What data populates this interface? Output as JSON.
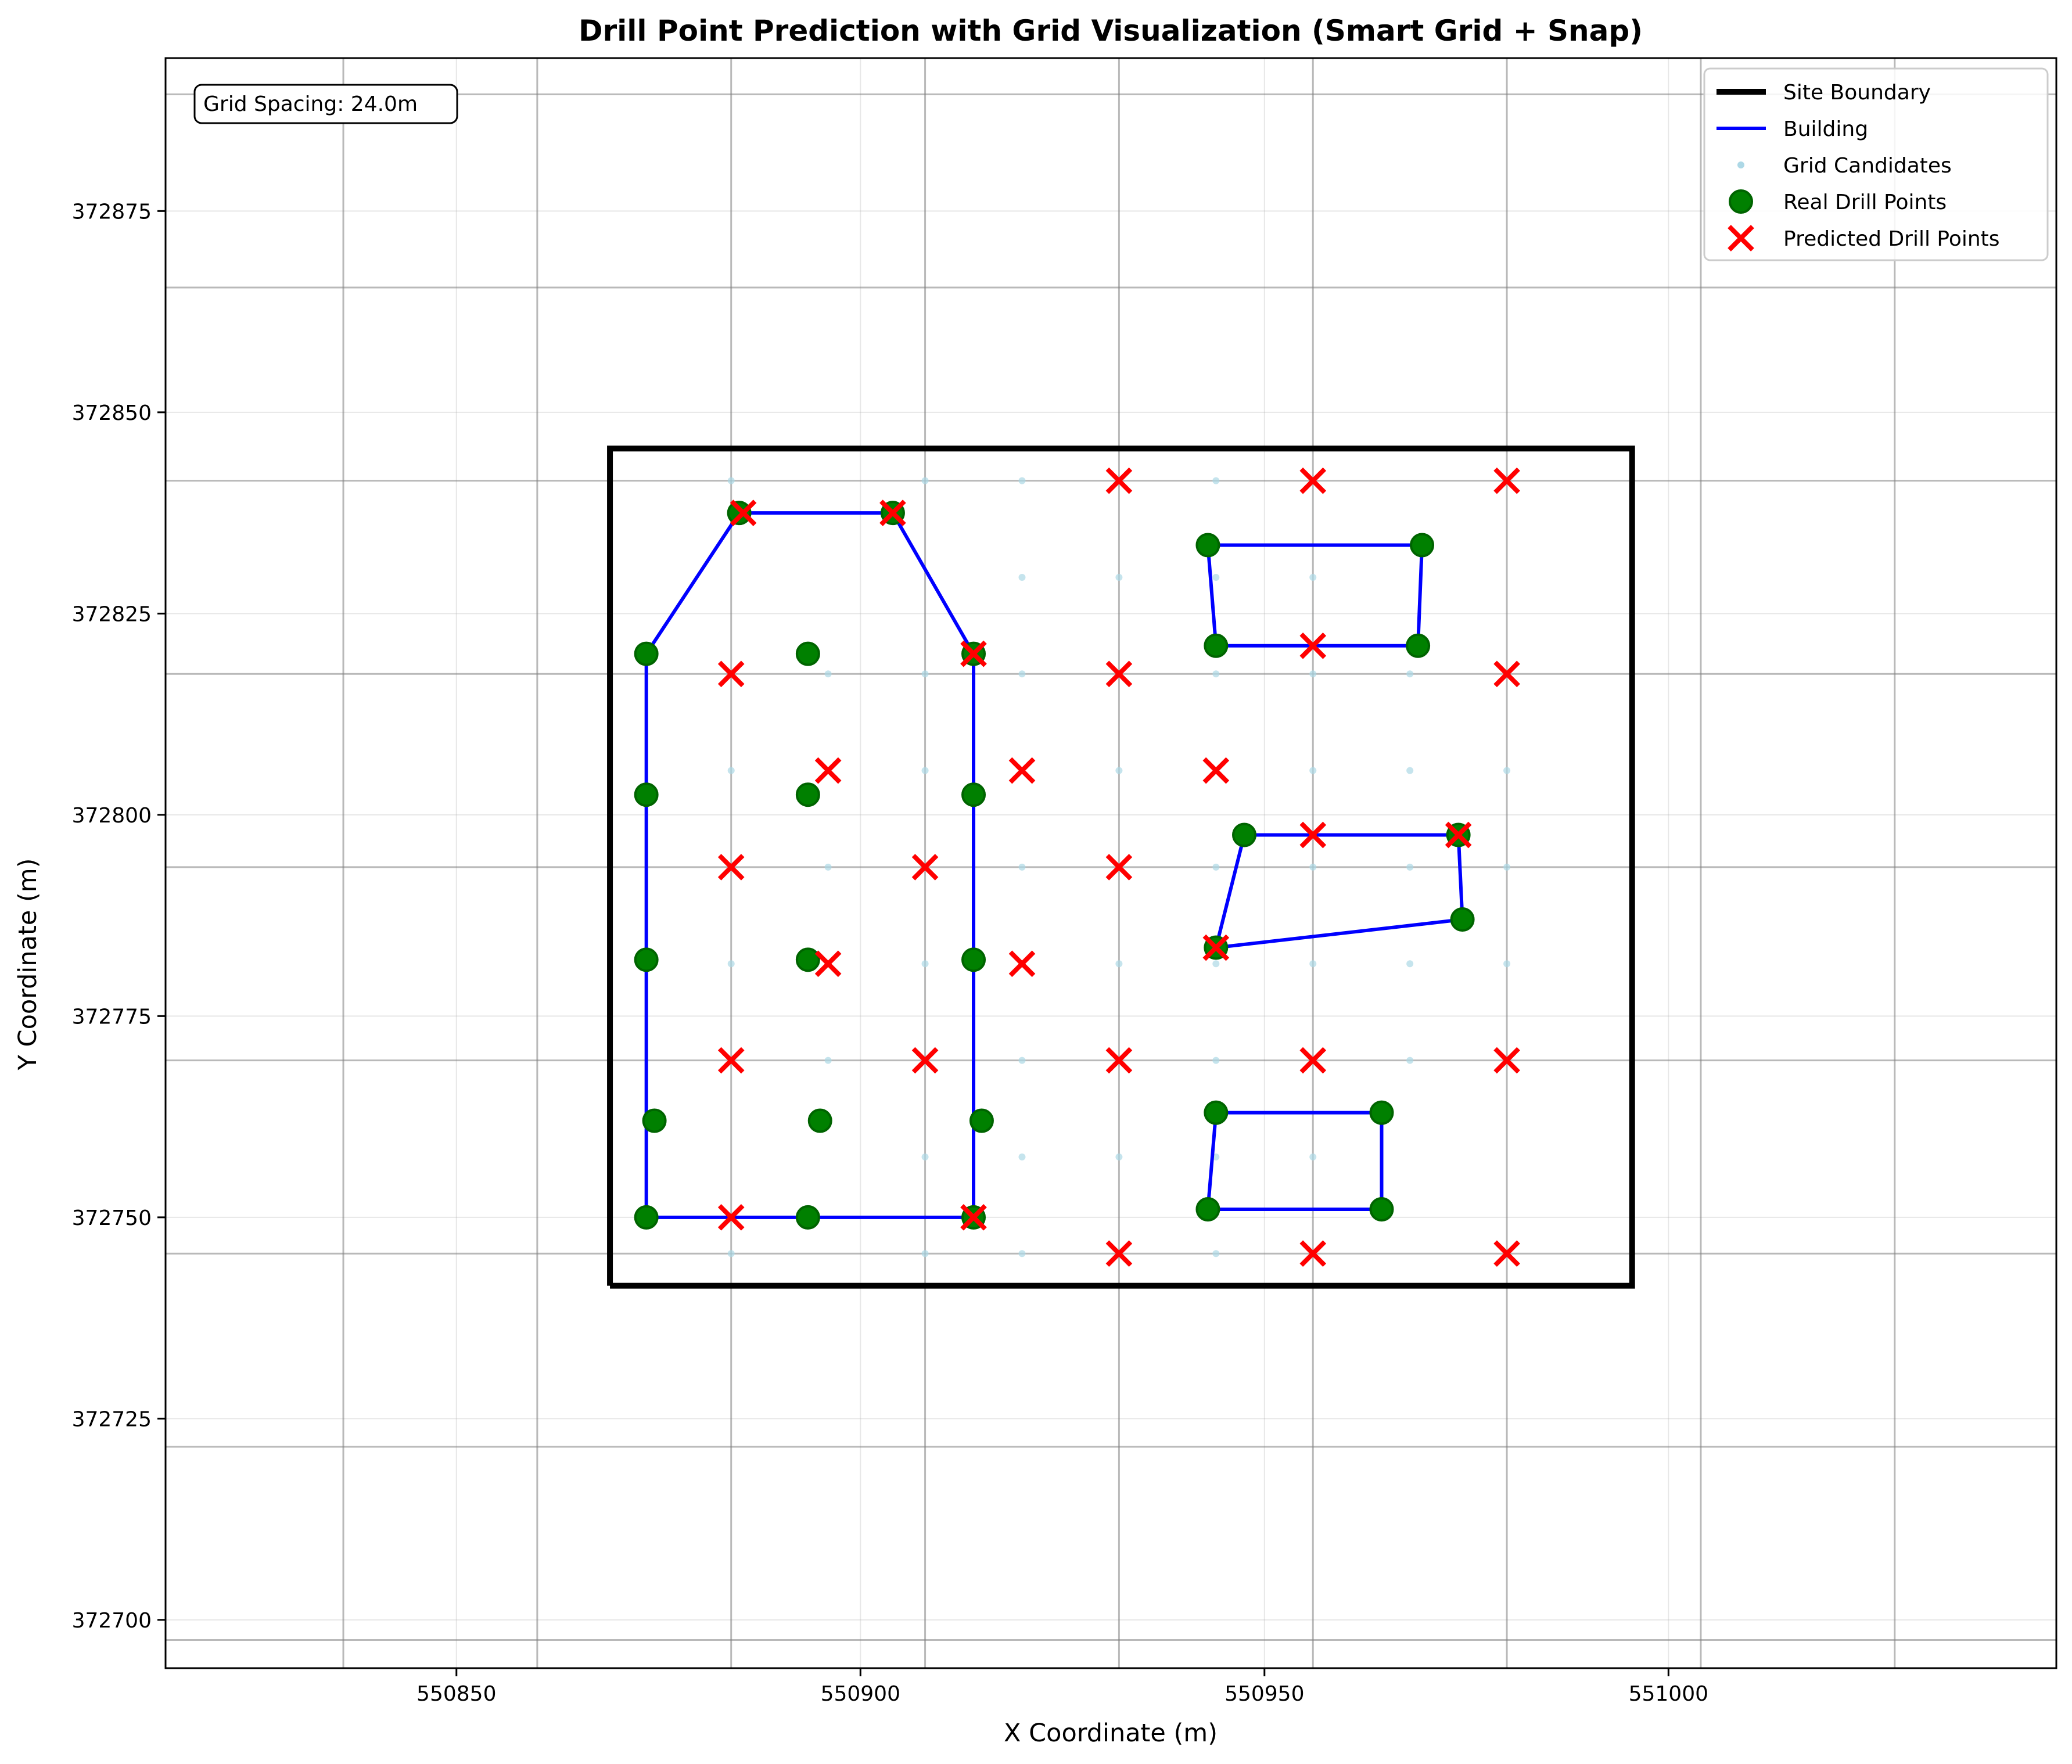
{
  "chart_data": {
    "type": "scatter",
    "title": "Drill Point Prediction with Grid Visualization (Smart Grid + Snap)",
    "xlabel": "X Coordinate (m)",
    "ylabel": "Y Coordinate (m)",
    "xlim": [
      550814,
      551048
    ],
    "ylim": [
      372694,
      372894
    ],
    "xticks": [
      550850,
      550900,
      550950,
      551000
    ],
    "yticks": [
      372700,
      372725,
      372750,
      372775,
      372800,
      372825,
      372850,
      372875
    ],
    "grid": true,
    "legend_position": "top-right",
    "annotation": "Grid Spacing: 24.0m",
    "grid_lines": {
      "x": [
        550836,
        550860,
        550884,
        550908,
        550932,
        550956,
        550980,
        551004,
        551028
      ],
      "y": [
        372697.5,
        372721.5,
        372745.5,
        372769.5,
        372793.5,
        372817.5,
        372841.5,
        372865.5,
        372889.5
      ]
    },
    "legend": [
      {
        "label": "Site Boundary",
        "kind": "line",
        "color": "#000000"
      },
      {
        "label": "Building",
        "kind": "line",
        "color": "#0000ff"
      },
      {
        "label": "Grid Candidates",
        "kind": "dot",
        "color": "#add8e6"
      },
      {
        "label": "Real Drill Points",
        "kind": "circle",
        "color": "#008000"
      },
      {
        "label": "Predicted Drill Points",
        "kind": "x",
        "color": "#ff0000"
      }
    ],
    "site_boundary": [
      [
        550869,
        372741.5
      ],
      [
        550995.5,
        372741.5
      ],
      [
        550995.5,
        372845.5
      ],
      [
        550869,
        372845.5
      ],
      [
        550869,
        372741.5
      ]
    ],
    "buildings": [
      [
        [
          550873.5,
          372750
        ],
        [
          550873.5,
          372820
        ],
        [
          550885,
          372837.5
        ],
        [
          550904,
          372837.5
        ],
        [
          550914,
          372820
        ],
        [
          550914,
          372750
        ],
        [
          550873.5,
          372750
        ]
      ],
      [
        [
          550943,
          372833.5
        ],
        [
          550969.5,
          372833.5
        ],
        [
          550969,
          372821
        ],
        [
          550944,
          372821
        ],
        [
          550943,
          372833.5
        ]
      ],
      [
        [
          550947.5,
          372797.5
        ],
        [
          550974,
          372797.5
        ],
        [
          550974.5,
          372787
        ],
        [
          550944,
          372783.5
        ],
        [
          550947.5,
          372797.5
        ]
      ],
      [
        [
          550944,
          372763
        ],
        [
          550964.5,
          372763
        ],
        [
          550964.5,
          372751
        ],
        [
          550943,
          372751
        ],
        [
          550944,
          372763
        ]
      ]
    ],
    "grid_candidates": [
      [
        550884,
        372841.5
      ],
      [
        550908,
        372841.5
      ],
      [
        550920,
        372841.5
      ],
      [
        550944,
        372841.5
      ],
      [
        550920,
        372829.5
      ],
      [
        550932,
        372829.5
      ],
      [
        550944,
        372829.5
      ],
      [
        550956,
        372829.5
      ],
      [
        550896,
        372817.5
      ],
      [
        550908,
        372817.5
      ],
      [
        550920,
        372817.5
      ],
      [
        550944,
        372817.5
      ],
      [
        550956,
        372817.5
      ],
      [
        550968,
        372817.5
      ],
      [
        550884,
        372805.5
      ],
      [
        550908,
        372805.5
      ],
      [
        550932,
        372805.5
      ],
      [
        550956,
        372805.5
      ],
      [
        550968,
        372805.5
      ],
      [
        550980,
        372805.5
      ],
      [
        550896,
        372793.5
      ],
      [
        550920,
        372793.5
      ],
      [
        550944,
        372793.5
      ],
      [
        550956,
        372793.5
      ],
      [
        550968,
        372793.5
      ],
      [
        550980,
        372793.5
      ],
      [
        550884,
        372781.5
      ],
      [
        550908,
        372781.5
      ],
      [
        550932,
        372781.5
      ],
      [
        550944,
        372781.5
      ],
      [
        550956,
        372781.5
      ],
      [
        550968,
        372781.5
      ],
      [
        550980,
        372781.5
      ],
      [
        550896,
        372769.5
      ],
      [
        550920,
        372769.5
      ],
      [
        550944,
        372769.5
      ],
      [
        550968,
        372769.5
      ],
      [
        550908,
        372757.5
      ],
      [
        550920,
        372757.5
      ],
      [
        550932,
        372757.5
      ],
      [
        550944,
        372757.5
      ],
      [
        550956,
        372757.5
      ],
      [
        550884,
        372745.5
      ],
      [
        550908,
        372745.5
      ],
      [
        550920,
        372745.5
      ],
      [
        550944,
        372745.5
      ]
    ],
    "real_drill_points": [
      [
        550873.5,
        372820
      ],
      [
        550885,
        372837.5
      ],
      [
        550904,
        372837.5
      ],
      [
        550914,
        372820
      ],
      [
        550893.5,
        372820
      ],
      [
        550873.5,
        372802.5
      ],
      [
        550893.5,
        372802.5
      ],
      [
        550914,
        372802.5
      ],
      [
        550873.5,
        372782
      ],
      [
        550893.5,
        372782
      ],
      [
        550914,
        372782
      ],
      [
        550874.5,
        372762
      ],
      [
        550895,
        372762
      ],
      [
        550915,
        372762
      ],
      [
        550873.5,
        372750
      ],
      [
        550893.5,
        372750
      ],
      [
        550914,
        372750
      ],
      [
        550943,
        372833.5
      ],
      [
        550969.5,
        372833.5
      ],
      [
        550944,
        372821
      ],
      [
        550969,
        372821
      ],
      [
        550947.5,
        372797.5
      ],
      [
        550974,
        372797.5
      ],
      [
        550974.5,
        372787
      ],
      [
        550944,
        372783.5
      ],
      [
        550944,
        372763
      ],
      [
        550964.5,
        372763
      ],
      [
        550943,
        372751
      ],
      [
        550964.5,
        372751
      ]
    ],
    "predicted_drill_points": [
      [
        550885.5,
        372837.5
      ],
      [
        550904,
        372837.5
      ],
      [
        550932,
        372841.5
      ],
      [
        550956,
        372841.5
      ],
      [
        550980,
        372841.5
      ],
      [
        550884,
        372817.5
      ],
      [
        550914,
        372820
      ],
      [
        550932,
        372817.5
      ],
      [
        550956,
        372821
      ],
      [
        550980,
        372817.5
      ],
      [
        550896,
        372805.5
      ],
      [
        550920,
        372805.5
      ],
      [
        550944,
        372805.5
      ],
      [
        550884,
        372793.5
      ],
      [
        550908,
        372793.5
      ],
      [
        550932,
        372793.5
      ],
      [
        550956,
        372797.5
      ],
      [
        550974,
        372797.5
      ],
      [
        550896,
        372781.5
      ],
      [
        550920,
        372781.5
      ],
      [
        550944,
        372783.5
      ],
      [
        550884,
        372769.5
      ],
      [
        550908,
        372769.5
      ],
      [
        550932,
        372769.5
      ],
      [
        550956,
        372769.5
      ],
      [
        550980,
        372769.5
      ],
      [
        550884,
        372750
      ],
      [
        550914,
        372750
      ],
      [
        550932,
        372745.5
      ],
      [
        550956,
        372745.5
      ],
      [
        550980,
        372745.5
      ]
    ]
  }
}
